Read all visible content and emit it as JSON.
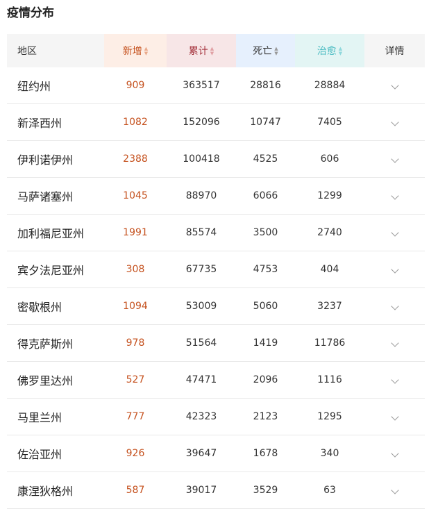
{
  "title": "疫情分布",
  "headers": {
    "region": "地区",
    "add": "新增",
    "total": "累计",
    "death": "死亡",
    "cured": "治愈",
    "detail": "详情"
  },
  "colors": {
    "add_bg": "#fdeee6",
    "add_fg": "#c5511e",
    "total_bg": "#f7e6e7",
    "total_fg": "#a3303a",
    "death_bg": "#e6f0fd",
    "death_fg": "#333333",
    "cured_bg": "#e3f5f4",
    "cured_fg": "#4bbcc2"
  },
  "rows": [
    {
      "region": "纽约州",
      "add": "909",
      "total": "363517",
      "death": "28816",
      "cured": "28884"
    },
    {
      "region": "新泽西州",
      "add": "1082",
      "total": "152096",
      "death": "10747",
      "cured": "7405"
    },
    {
      "region": "伊利诺伊州",
      "add": "2388",
      "total": "100418",
      "death": "4525",
      "cured": "606"
    },
    {
      "region": "马萨诸塞州",
      "add": "1045",
      "total": "88970",
      "death": "6066",
      "cured": "1299"
    },
    {
      "region": "加利福尼亚州",
      "add": "1991",
      "total": "85574",
      "death": "3500",
      "cured": "2740"
    },
    {
      "region": "宾夕法尼亚州",
      "add": "308",
      "total": "67735",
      "death": "4753",
      "cured": "404"
    },
    {
      "region": "密歇根州",
      "add": "1094",
      "total": "53009",
      "death": "5060",
      "cured": "3237"
    },
    {
      "region": "得克萨斯州",
      "add": "978",
      "total": "51564",
      "death": "1419",
      "cured": "11786"
    },
    {
      "region": "佛罗里达州",
      "add": "527",
      "total": "47471",
      "death": "2096",
      "cured": "1116"
    },
    {
      "region": "马里兰州",
      "add": "777",
      "total": "42323",
      "death": "2123",
      "cured": "1295"
    },
    {
      "region": "佐治亚州",
      "add": "926",
      "total": "39647",
      "death": "1678",
      "cured": "340"
    },
    {
      "region": "康涅狄格州",
      "add": "587",
      "total": "39017",
      "death": "3529",
      "cured": "63"
    }
  ]
}
